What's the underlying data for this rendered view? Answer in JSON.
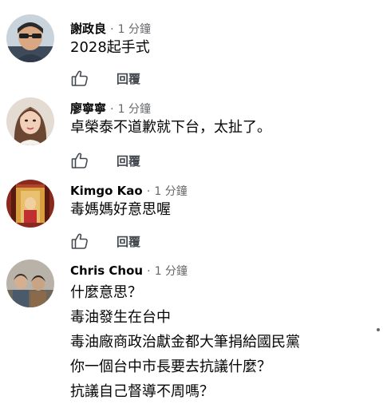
{
  "comments": [
    {
      "author": "謝政良",
      "separator": "·",
      "time": "1 分鐘",
      "lines": [
        "2028起手式"
      ],
      "reply_label": "回覆",
      "avatar": "avatar-man-sunglasses"
    },
    {
      "author": "廖寧寧",
      "separator": "·",
      "time": "1 分鐘",
      "lines": [
        "卓榮泰不道歉就下台，太扯了。"
      ],
      "reply_label": "回覆",
      "avatar": "avatar-woman-portrait"
    },
    {
      "author": "Kimgo Kao",
      "separator": "·",
      "time": "1 分鐘",
      "lines": [
        "毒媽媽好意思喔"
      ],
      "reply_label": "回覆",
      "avatar": "avatar-shrine-photo"
    },
    {
      "author": "Chris Chou",
      "separator": "·",
      "time": "1 分鐘",
      "lines": [
        "什麼意思？",
        "毒油發生在台中",
        "毒油廠商政治獻金都大筆捐給國民黨",
        "你一個台中市長要去抗議什麼？",
        "抗議自己督導不周嗎？"
      ],
      "avatar": "avatar-group-photo"
    }
  ],
  "icons": {
    "like": "thumbs-up-outline-icon"
  },
  "colors": {
    "author_text": "#050505",
    "meta_text": "#65676b",
    "reply_text": "#444950"
  }
}
